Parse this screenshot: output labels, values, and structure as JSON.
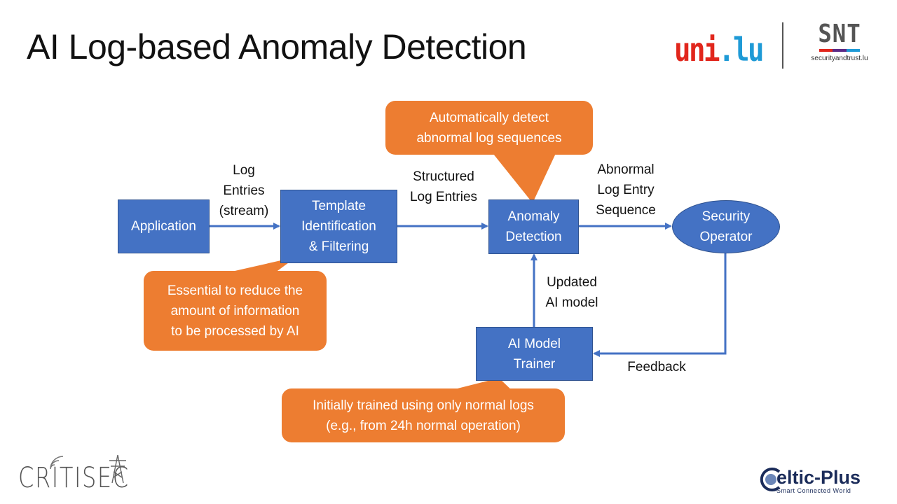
{
  "slide": {
    "title": "AI Log-based Anomaly Detection"
  },
  "logos": {
    "unilu": {
      "part1": "uni",
      "dot": ".",
      "part2": "lu",
      "red": "#e1261c",
      "blue": "#1e9ad6"
    },
    "snt": {
      "mark": "SNT",
      "url": "securityandtrust.lu",
      "bar_colors": [
        "#e1261c",
        "#5b2a86",
        "#1e9ad6"
      ]
    },
    "critisec": {
      "name": "CRITISEC"
    },
    "celtic": {
      "name": "eltic-Plus",
      "tagline": "Smart Connected World"
    }
  },
  "colors": {
    "node_fill": "#4472c4",
    "node_border": "#2f528f",
    "arrow": "#4472c4",
    "callout_fill": "#ed7d31"
  },
  "nodes": {
    "application": "Application",
    "template": "Template\nIdentification\n& Filtering",
    "anomaly": "Anomaly\nDetection",
    "operator": "Security\nOperator",
    "trainer": "AI Model\nTrainer"
  },
  "edges": {
    "log_entries": "Log\nEntries\n(stream)",
    "structured": "Structured\nLog Entries",
    "abnormal": "Abnormal\nLog Entry\nSequence",
    "updated_model": "Updated\nAI model",
    "feedback": "Feedback"
  },
  "callouts": {
    "detect": "Automatically detect\nabnormal log sequences",
    "essential": "Essential to reduce the\namount of information\nto be processed by AI",
    "trained": "Initially trained using only normal logs\n(e.g., from 24h normal operation)"
  }
}
